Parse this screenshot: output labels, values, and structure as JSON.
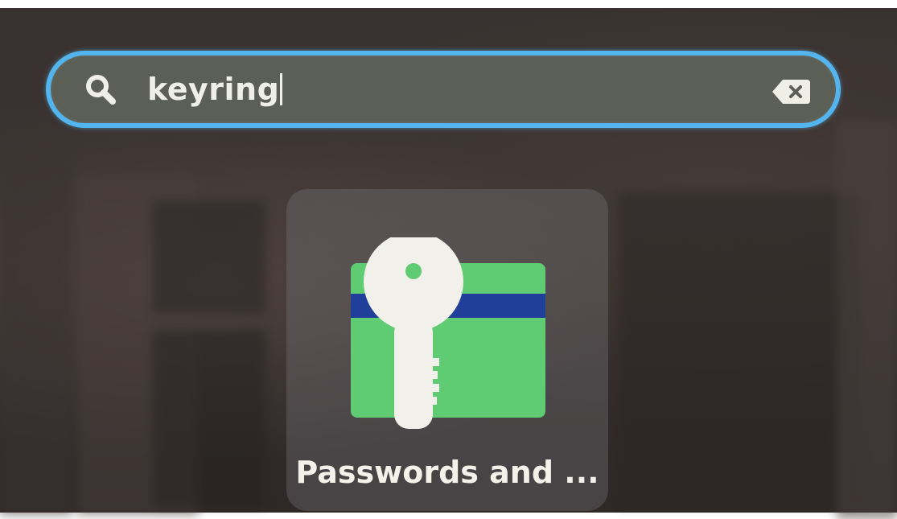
{
  "search": {
    "query": "keyring",
    "icon": "search-icon",
    "clear_icon": "backspace-clear-icon"
  },
  "results": [
    {
      "label": "Passwords and ...",
      "icon": "keyring-key-card-icon"
    }
  ],
  "colors": {
    "entry_border": "#53b4ee",
    "entry_fill": "#5b5f55",
    "card_green": "#5fcb72",
    "card_stripe": "#1f3f9a",
    "key_white": "#f2f0ea",
    "text": "#efefe6"
  }
}
